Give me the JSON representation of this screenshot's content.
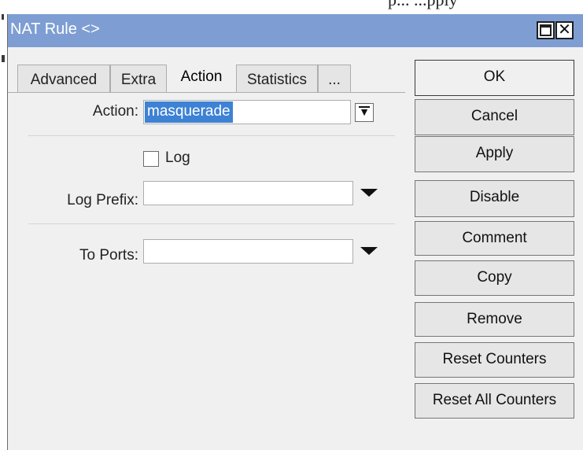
{
  "background": {
    "partial_text": "p... ...pply"
  },
  "window": {
    "title": "NAT Rule <>",
    "maximize_glyph": "□",
    "close_glyph": "✕"
  },
  "tabs": [
    {
      "label": "Advanced"
    },
    {
      "label": "Extra"
    },
    {
      "label": "Action",
      "active": true
    },
    {
      "label": "Statistics"
    },
    {
      "label": "..."
    }
  ],
  "form": {
    "action": {
      "label": "Action:",
      "value": "masquerade",
      "dropdown_icon": "dropdown-arrow-icon"
    },
    "log": {
      "label": "Log",
      "checked": false
    },
    "log_prefix": {
      "label": "Log Prefix:",
      "value": ""
    },
    "to_ports": {
      "label": "To Ports:",
      "value": ""
    }
  },
  "buttons": {
    "ok": "OK",
    "cancel": "Cancel",
    "apply": "Apply",
    "disable": "Disable",
    "comment": "Comment",
    "copy": "Copy",
    "remove": "Remove",
    "reset_counters": "Reset Counters",
    "reset_all_counters": "Reset All Counters"
  },
  "colors": {
    "titlebar": "#7e9ed3",
    "selection": "#3d82d4",
    "window_bg": "#f0f0f0"
  }
}
